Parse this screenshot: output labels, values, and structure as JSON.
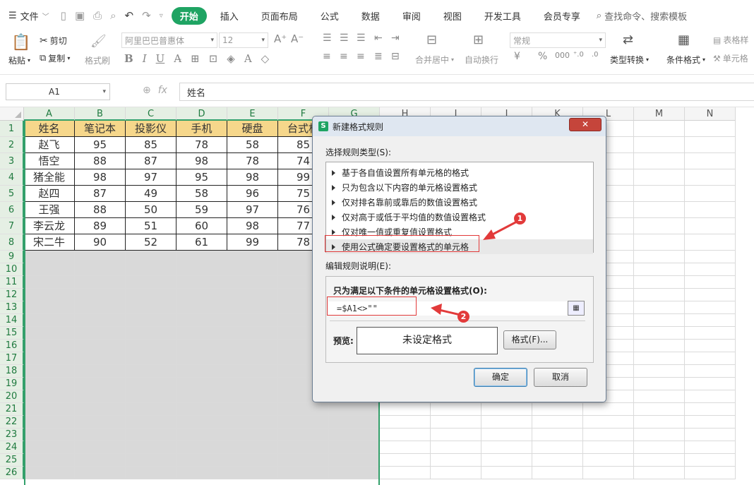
{
  "menubar": {
    "file_label": "文件",
    "tabs": [
      "开始",
      "插入",
      "页面布局",
      "公式",
      "数据",
      "审阅",
      "视图",
      "开发工具",
      "会员专享"
    ],
    "active_tab": "开始",
    "search_label": "查找命令、搜索模板"
  },
  "ribbon": {
    "paste": "粘贴",
    "cut": "剪切",
    "copy": "复制",
    "format_painter": "格式刷",
    "font_name": "阿里巴巴普惠体",
    "font_size": "12",
    "merge_center": "合并居中",
    "wrap_text": "自动换行",
    "number_format": "常规",
    "type_convert": "类型转换",
    "cond_format": "条件格式",
    "table_style": "表格样",
    "cell_style": "单元格"
  },
  "formula_bar": {
    "name_box": "A1",
    "formula": "姓名"
  },
  "sheet": {
    "columns": [
      "A",
      "B",
      "C",
      "D",
      "E",
      "F",
      "G",
      "H",
      "I",
      "J",
      "K",
      "L",
      "M",
      "N"
    ],
    "rows": [
      "1",
      "2",
      "3",
      "4",
      "5",
      "6",
      "7",
      "8",
      "9",
      "10",
      "11",
      "12",
      "13",
      "14",
      "15",
      "16",
      "17",
      "18",
      "19",
      "20",
      "21",
      "22",
      "23",
      "24",
      "25",
      "26"
    ],
    "header_fill": "#f6d78b",
    "selection_fill": "#d9d9d9",
    "data": [
      [
        "姓名",
        "笔记本",
        "投影仪",
        "手机",
        "硬盘",
        "台式机"
      ],
      [
        "赵飞",
        "95",
        "85",
        "78",
        "58",
        "85"
      ],
      [
        "悟空",
        "88",
        "87",
        "98",
        "78",
        "74"
      ],
      [
        "猪全能",
        "98",
        "97",
        "95",
        "98",
        "99"
      ],
      [
        "赵四",
        "87",
        "49",
        "58",
        "96",
        "75"
      ],
      [
        "王强",
        "88",
        "50",
        "59",
        "97",
        "76"
      ],
      [
        "李云龙",
        "89",
        "51",
        "60",
        "98",
        "77"
      ],
      [
        "宋二牛",
        "90",
        "52",
        "61",
        "99",
        "78"
      ]
    ]
  },
  "dialog": {
    "title": "新建格式规则",
    "close_label": "✕",
    "select_type_label": "选择规则类型(S):",
    "rule_types": [
      "基于各自值设置所有单元格的格式",
      "只为包含以下内容的单元格设置格式",
      "仅对排名靠前或靠后的数值设置格式",
      "仅对高于或低于平均值的数值设置格式",
      "仅对唯一值或重复值设置格式",
      "使用公式确定要设置格式的单元格"
    ],
    "selected_rule_index": 5,
    "edit_desc_label": "编辑规则说明(E):",
    "formula_caption": "只为满足以下条件的单元格设置格式(O):",
    "formula": "=$A1<>\"\"",
    "preview_label": "预览:",
    "preview_text": "未设定格式",
    "format_button": "格式(F)...",
    "ok_button": "确定",
    "cancel_button": "取消",
    "annotation_1": "1",
    "annotation_2": "2",
    "annotation_color": "#e23a3a"
  }
}
